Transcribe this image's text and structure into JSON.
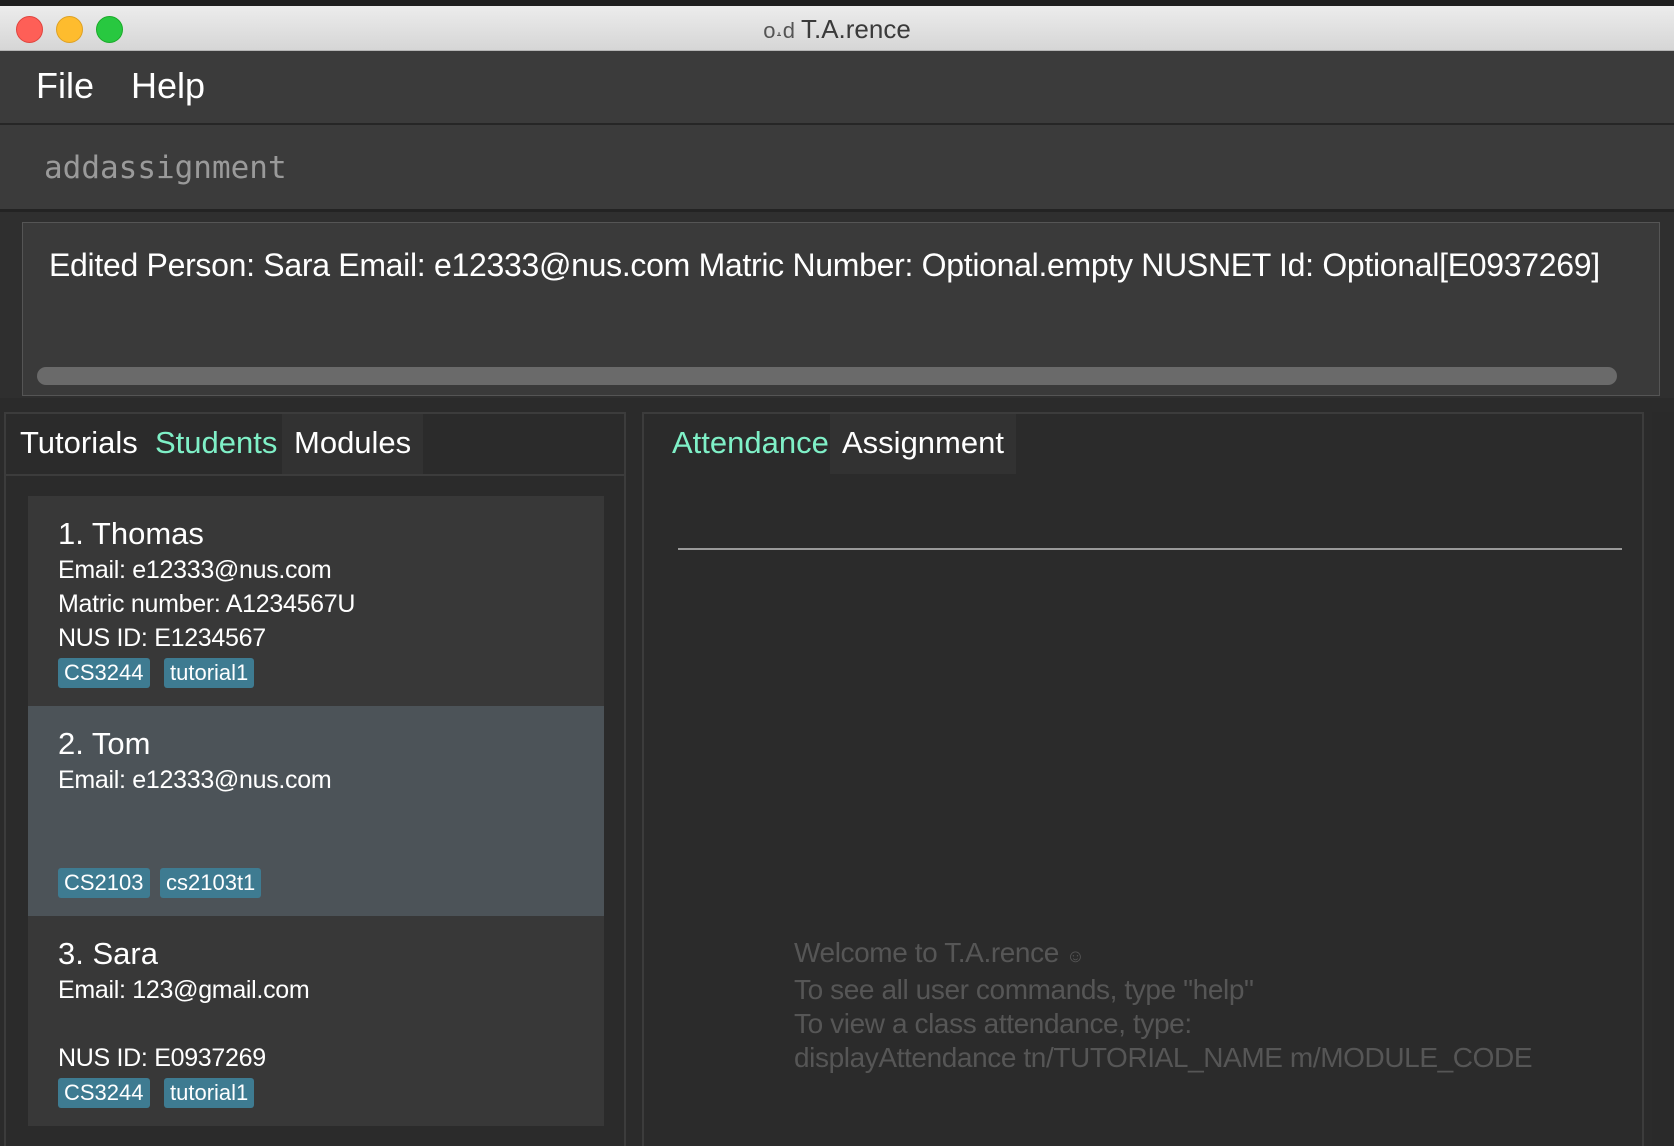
{
  "window": {
    "title": "T.A.rence",
    "title_icon": "glasses-icon"
  },
  "menu": {
    "file": "File",
    "help": "Help"
  },
  "command": {
    "value": "addassignment"
  },
  "result": {
    "text": "Edited Person: Sara Email: e12333@nus.com Matric Number: Optional.empty NUSNET Id: Optional[E0937269]"
  },
  "left_tabs": [
    {
      "label": "Tutorials"
    },
    {
      "label": "Students"
    },
    {
      "label": "Modules"
    }
  ],
  "students": [
    {
      "name": "1.  Thomas",
      "email": "Email: e12333@nus.com",
      "matric": "Matric number: A1234567U",
      "nusid": "NUS ID: E1234567",
      "tags": [
        "CS3244",
        "tutorial1"
      ]
    },
    {
      "name": "2.  Tom",
      "email": "Email: e12333@nus.com",
      "matric": "",
      "nusid": "",
      "tags": [
        "CS2103",
        "cs2103t1"
      ]
    },
    {
      "name": "3.  Sara",
      "email": "Email: 123@gmail.com",
      "matric": "",
      "nusid": "NUS ID: E0937269",
      "tags": [
        "CS3244",
        "tutorial1"
      ]
    }
  ],
  "right_tabs": [
    {
      "label": "Attendance"
    },
    {
      "label": "Assignment"
    }
  ],
  "welcome": {
    "line1": "Welcome to T.A.rence",
    "line2": "To see all user commands, type \"help\"",
    "line3": "To view a class attendance, type:",
    "line4": "displayAttendance tn/TUTORIAL_NAME m/MODULE_CODE"
  },
  "colors": {
    "accent_tab": "#7ff0c7",
    "tag_bg": "#3e7b91",
    "selected_card": "#4c5358",
    "background": "#2b2b2b"
  }
}
